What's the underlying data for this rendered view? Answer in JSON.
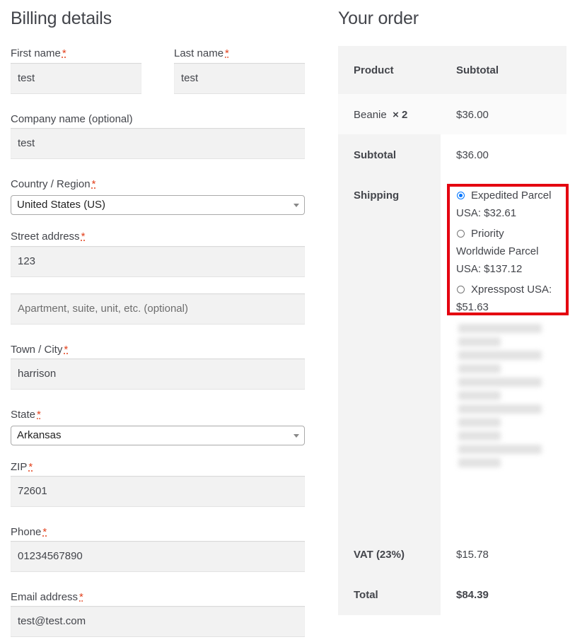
{
  "billing": {
    "heading": "Billing details",
    "first_name": {
      "label": "First name",
      "value": "test"
    },
    "last_name": {
      "label": "Last name",
      "value": "test"
    },
    "company": {
      "label": "Company name (optional)",
      "value": "test"
    },
    "country": {
      "label": "Country / Region",
      "value": "United States (US)"
    },
    "street": {
      "label": "Street address",
      "value": "123",
      "placeholder2": "Apartment, suite, unit, etc. (optional)"
    },
    "city": {
      "label": "Town / City",
      "value": "harrison"
    },
    "state": {
      "label": "State",
      "value": "Arkansas"
    },
    "zip": {
      "label": "ZIP",
      "value": "72601"
    },
    "phone": {
      "label": "Phone",
      "value": "01234567890"
    },
    "email": {
      "label": "Email address",
      "value": "test@test.com"
    },
    "required_mark": "*"
  },
  "order": {
    "heading": "Your order",
    "col_product": "Product",
    "col_subtotal": "Subtotal",
    "item_name": "Beanie",
    "item_qty": "× 2",
    "item_total": "$36.00",
    "subtotal_label": "Subtotal",
    "subtotal_value": "$36.00",
    "shipping_label": "Shipping",
    "shipping_options": [
      {
        "label": "Expedited Parcel USA: $32.61",
        "selected": true
      },
      {
        "label": "Priority Worldwide Parcel USA: $137.12",
        "selected": false
      },
      {
        "label": "Xpresspost USA: $51.63",
        "selected": false
      }
    ],
    "vat_label": "VAT (23%)",
    "vat_value": "$15.78",
    "total_label": "Total",
    "total_value": "$84.39"
  },
  "colors": {
    "highlight": "#e4000f",
    "radio_selected": "#0075ff",
    "required": "#e2401c",
    "table_bg": "#f8f8f8",
    "table_header_bg": "#f3f3f3"
  }
}
